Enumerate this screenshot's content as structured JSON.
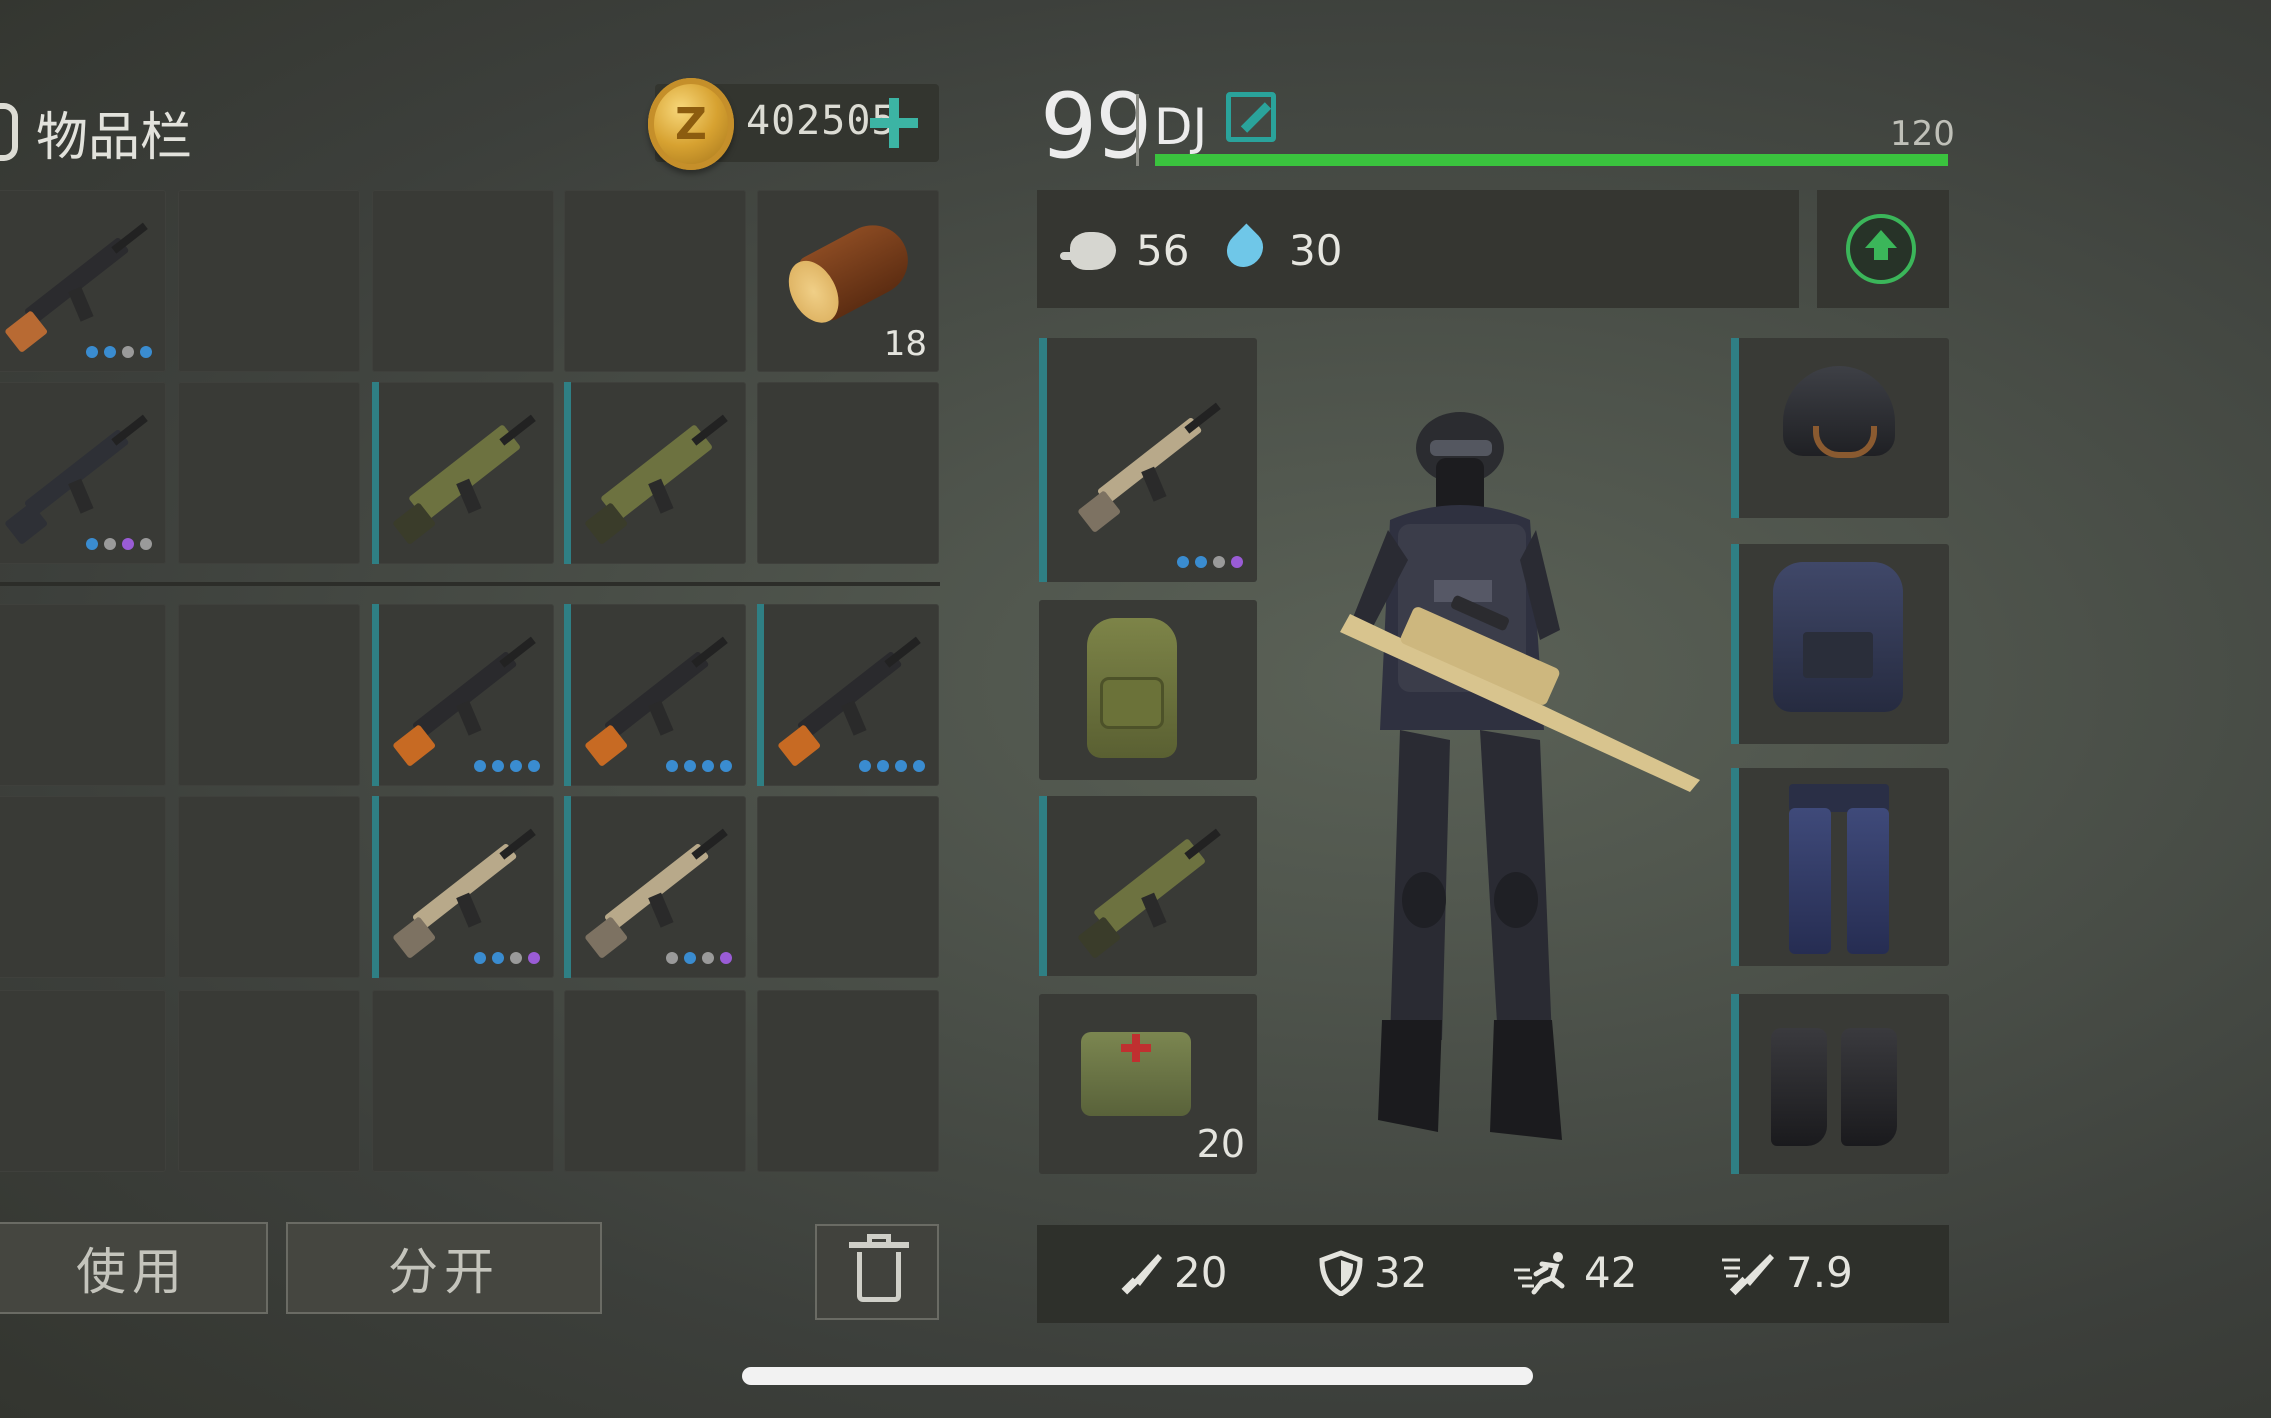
{
  "inventory": {
    "title": "物品栏",
    "coins": "402505",
    "add_label": "+",
    "use_label": "使用",
    "split_label": "分开"
  },
  "character": {
    "level": "99",
    "name": "DJ",
    "xp_max": "120",
    "xp_fraction": 1.0,
    "food": "56",
    "water": "30"
  },
  "grid": [
    {
      "item": "shotgun",
      "dots": [
        "#3a8cd0",
        "#3a8cd0",
        "#9a9a9a",
        "#3a8cd0"
      ]
    },
    {
      "item": "empty"
    },
    {
      "item": "empty"
    },
    {
      "item": "empty"
    },
    {
      "item": "log",
      "qty": "18"
    },
    {
      "item": "assault-rifle",
      "dots": [
        "#3a8cd0",
        "#9a9a9a",
        "#9a5cd6",
        "#9a9a9a"
      ]
    },
    {
      "item": "empty"
    },
    {
      "item": "grenade-launcher",
      "accent": true
    },
    {
      "item": "grenade-launcher",
      "accent": true
    },
    {
      "item": "empty"
    },
    {
      "item": "empty"
    },
    {
      "item": "empty"
    },
    {
      "item": "sniper-rifle",
      "accent": true,
      "dots": [
        "#3a8cd0",
        "#3a8cd0",
        "#3a8cd0",
        "#3a8cd0"
      ]
    },
    {
      "item": "sniper-rifle",
      "accent": true,
      "dots": [
        "#3a8cd0",
        "#3a8cd0",
        "#3a8cd0",
        "#3a8cd0"
      ]
    },
    {
      "item": "sniper-rifle",
      "accent": true,
      "dots": [
        "#3a8cd0",
        "#3a8cd0",
        "#3a8cd0",
        "#3a8cd0"
      ]
    },
    {
      "item": "empty"
    },
    {
      "item": "empty"
    },
    {
      "item": "scar-rifle",
      "accent": true,
      "dots": [
        "#3a8cd0",
        "#3a8cd0",
        "#9a9a9a",
        "#9a5cd6"
      ]
    },
    {
      "item": "scar-rifle",
      "accent": true,
      "dots": [
        "#9a9a9a",
        "#3a8cd0",
        "#9a9a9a",
        "#9a5cd6"
      ]
    },
    {
      "item": "empty"
    },
    {
      "item": "empty"
    },
    {
      "item": "empty"
    },
    {
      "item": "empty"
    },
    {
      "item": "empty"
    },
    {
      "item": "empty"
    }
  ],
  "equipment": {
    "weapon": {
      "item": "scar-rifle",
      "dots": [
        "#3a8cd0",
        "#3a8cd0",
        "#9a9a9a",
        "#9a5cd6"
      ]
    },
    "backpack": {
      "item": "backpack"
    },
    "secondary": {
      "item": "grenade-launcher"
    },
    "medkit": {
      "item": "medkit",
      "qty": "20"
    },
    "helmet": {
      "item": "helmet"
    },
    "vest": {
      "item": "police-vest"
    },
    "pants": {
      "item": "pants"
    },
    "boots": {
      "item": "boots"
    }
  },
  "stats": {
    "attack": "20",
    "defense": "32",
    "speed": "42",
    "weight": "7.9"
  },
  "colors": {
    "accent_teal": "#2f7f84",
    "xp_green": "#3ac33e",
    "plus_teal": "#3cb4a4"
  }
}
